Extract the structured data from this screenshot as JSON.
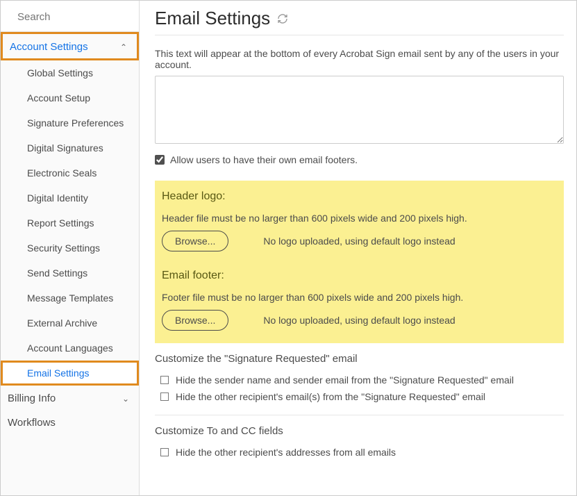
{
  "search": {
    "placeholder": "Search"
  },
  "sidebar": {
    "sections": {
      "account": {
        "label": "Account Settings"
      },
      "billing": {
        "label": "Billing Info"
      },
      "workflows": {
        "label": "Workflows"
      }
    },
    "items": [
      "Global Settings",
      "Account Setup",
      "Signature Preferences",
      "Digital Signatures",
      "Electronic Seals",
      "Digital Identity",
      "Report Settings",
      "Security Settings",
      "Send Settings",
      "Message Templates",
      "External Archive",
      "Account Languages",
      "Email Settings"
    ]
  },
  "page": {
    "title": "Email Settings",
    "footerDescription": "This text will appear at the bottom of every Acrobat Sign email sent by any of the users in your account.",
    "allowOwnFooters": "Allow users to have their own email footers."
  },
  "highlight": {
    "headerLogo": {
      "heading": "Header logo:",
      "desc": "Header file must be no larger than 600 pixels wide and 200 pixels high.",
      "browse": "Browse...",
      "status": "No logo uploaded, using default logo instead"
    },
    "emailFooter": {
      "heading": "Email footer:",
      "desc": "Footer file must be no larger than 600 pixels wide and 200 pixels high.",
      "browse": "Browse...",
      "status": "No logo uploaded, using default logo instead"
    }
  },
  "sigRequested": {
    "heading": "Customize the \"Signature Requested\" email",
    "hideSender": "Hide the sender name and sender email from the \"Signature Requested\" email",
    "hideOther": "Hide the other recipient's email(s) from the \"Signature Requested\" email"
  },
  "toCc": {
    "heading": "Customize To and CC fields",
    "hideOther": "Hide the other recipient's addresses from all emails"
  }
}
